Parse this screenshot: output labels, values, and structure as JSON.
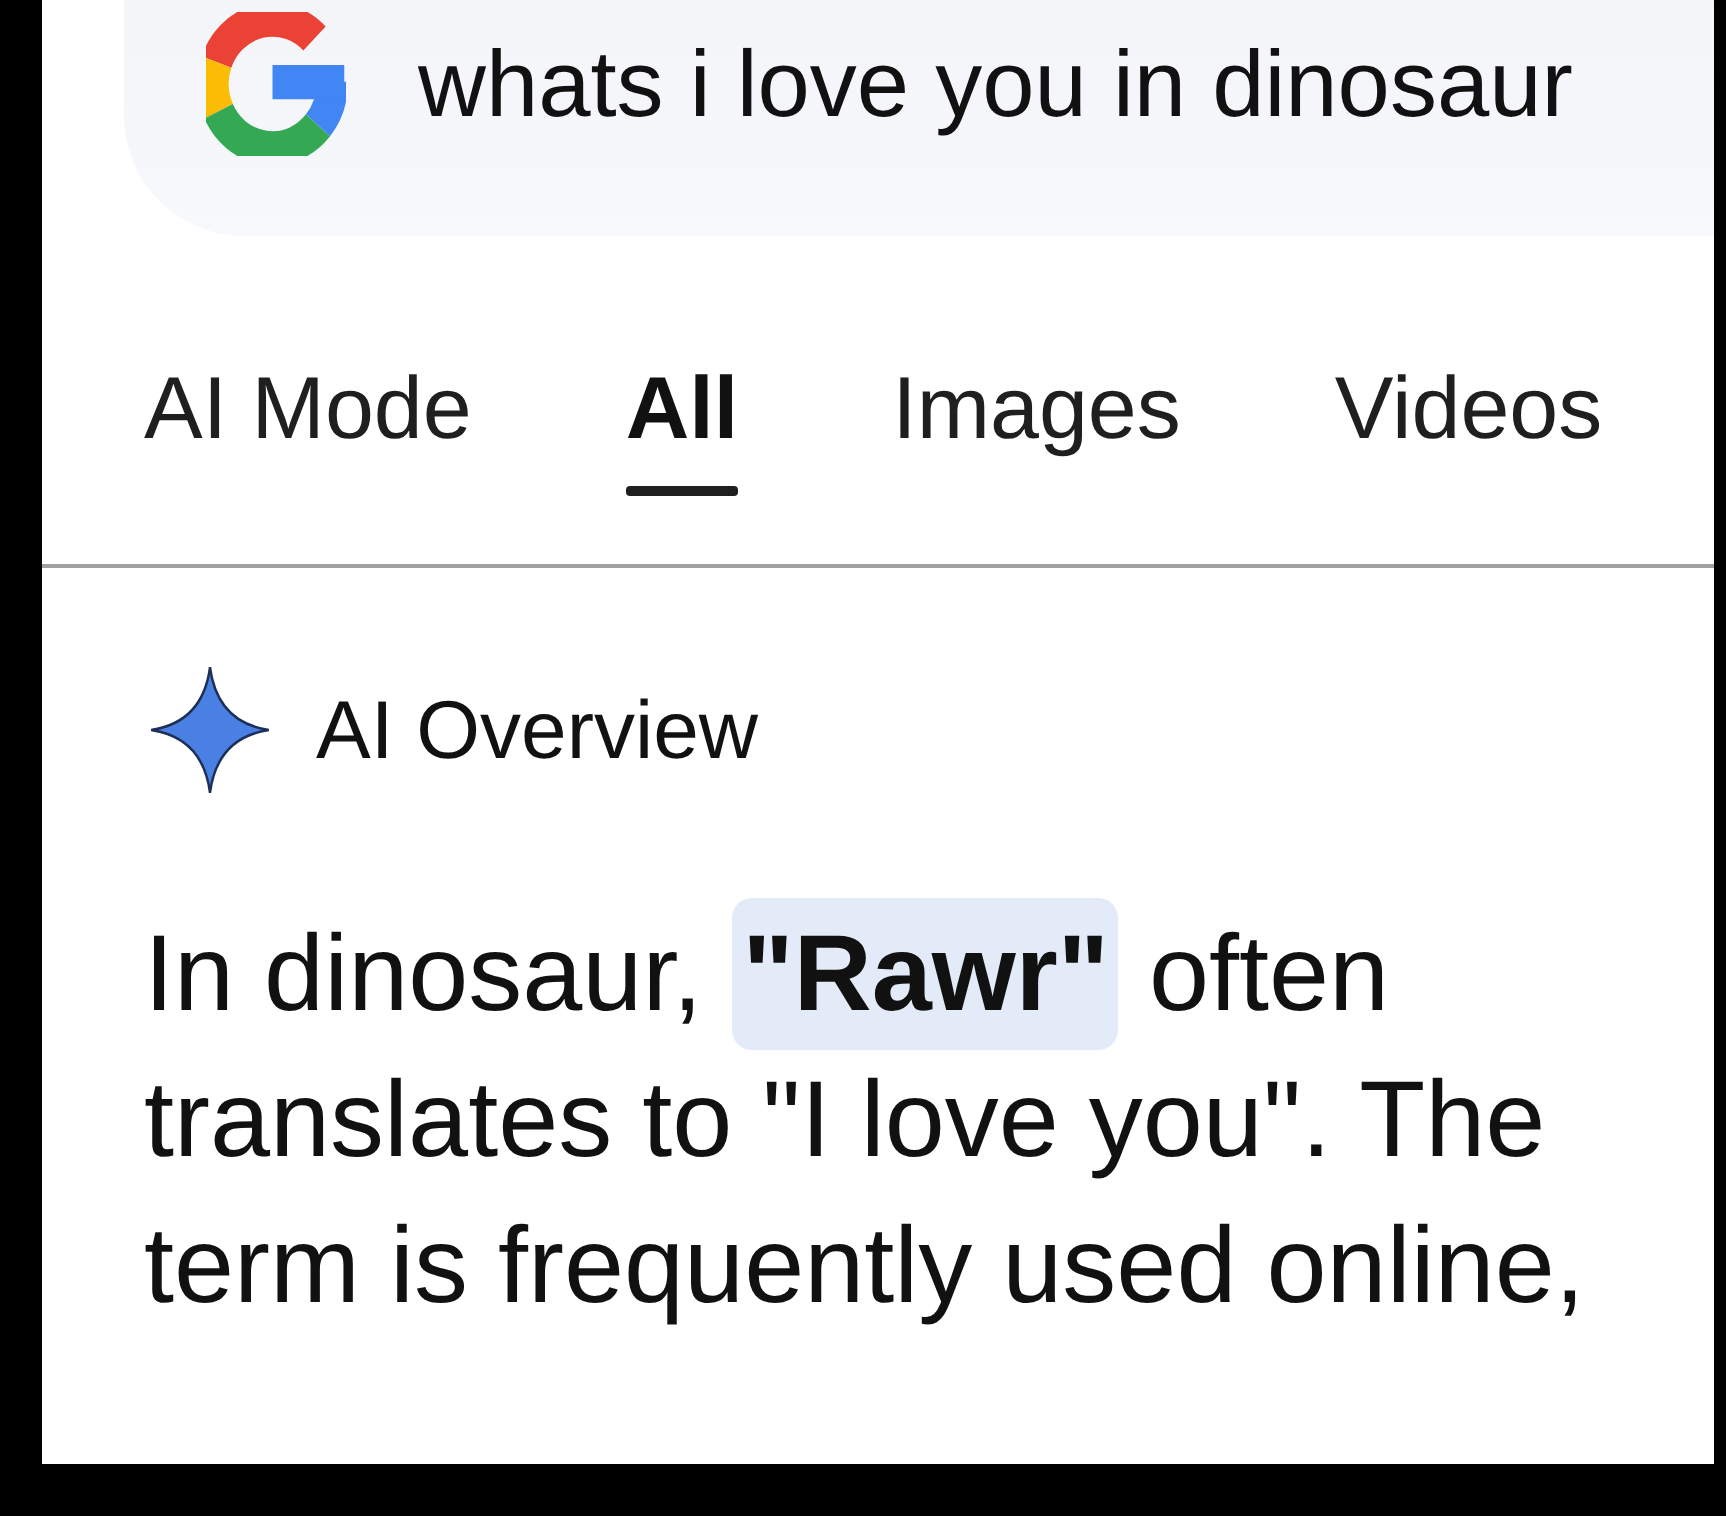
{
  "search": {
    "value": "whats i love you in dinosaur"
  },
  "tabs": [
    {
      "label": "AI Mode",
      "selected": false
    },
    {
      "label": "All",
      "selected": true
    },
    {
      "label": "Images",
      "selected": false
    },
    {
      "label": "Videos",
      "selected": false
    }
  ],
  "ai_overview": {
    "title": "AI Overview",
    "text": "In dinosaur, **\"Rawr\"** often translates to \"I love you\". The term is frequently used online,"
  }
}
